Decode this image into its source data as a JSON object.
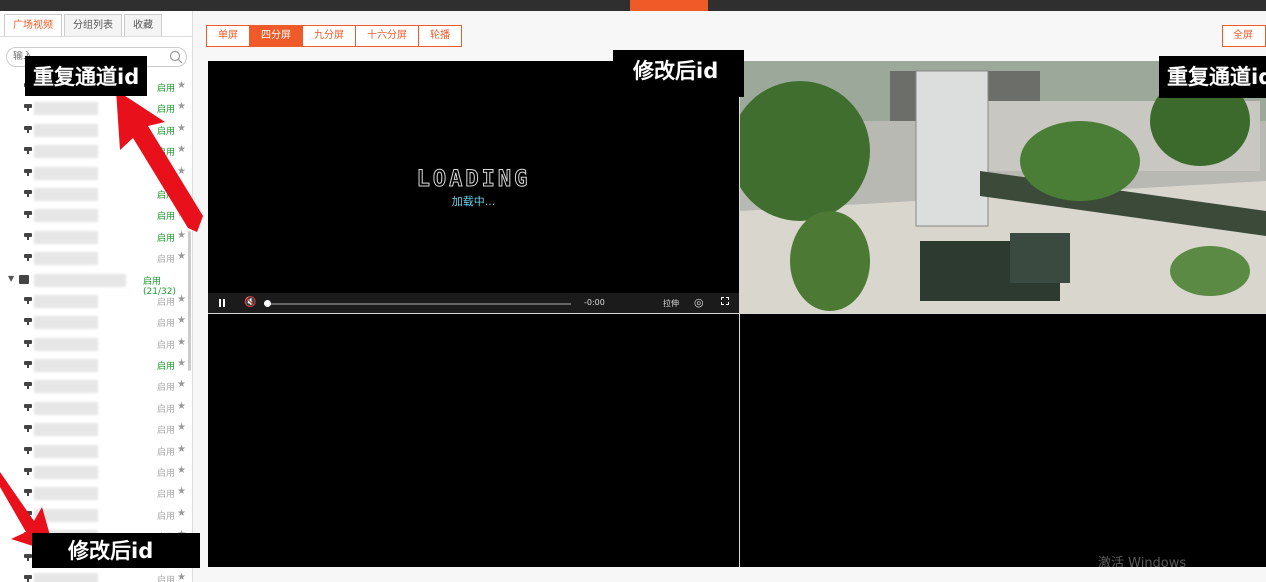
{
  "left_panel": {
    "tabs": [
      "广场视频",
      "分组列表",
      "收藏"
    ],
    "search_placeholder": "输入",
    "status_on": "启用",
    "group_status": "启用 (21/32)",
    "group_name_suffix": "..."
  },
  "toolbar": {
    "split_buttons": [
      "单屏",
      "四分屏",
      "九分屏",
      "十六分屏",
      "轮播"
    ],
    "active_index": 1,
    "fullscreen_label": "全屏"
  },
  "player": {
    "loading_title": "LOADING",
    "loading_sub": "加载中...",
    "time": "-0:00",
    "stretch_label": "拉伸"
  },
  "annotations": {
    "top_left": "重复通道id",
    "top_center": "修改后id",
    "top_right": "重复通道id",
    "bottom_left": "修改后id"
  },
  "watermark": "激活 Windows",
  "colors": {
    "accent": "#f05a28",
    "status_on": "#1a9b2c",
    "annotation_arrow": "#e8101a"
  }
}
